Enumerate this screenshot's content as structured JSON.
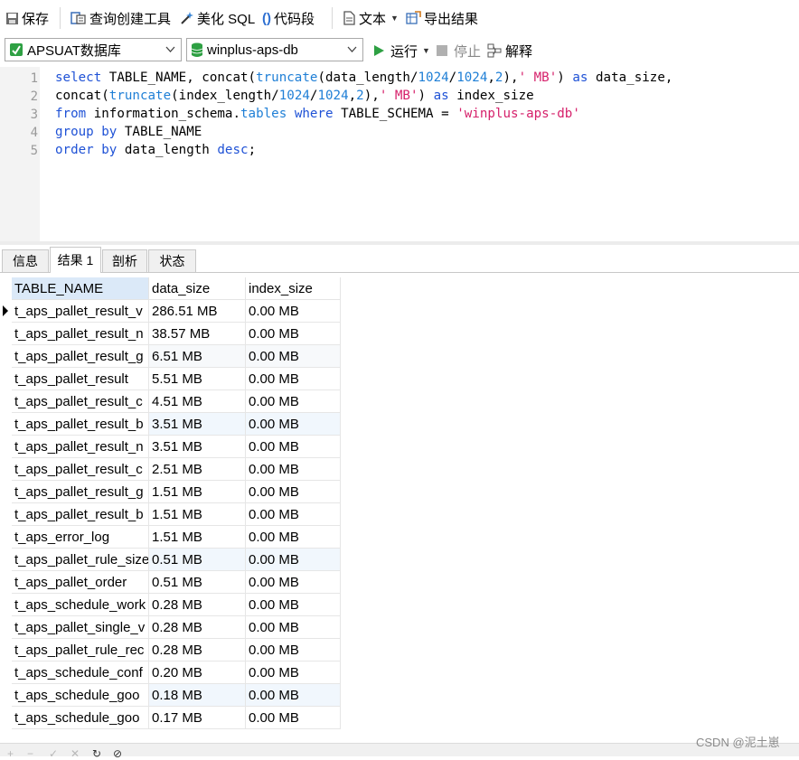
{
  "toolbar": {
    "save": "保存",
    "query_builder": "查询创建工具",
    "beautify": "美化 SQL",
    "snippet": "代码段",
    "text": "文本",
    "export": "导出结果"
  },
  "connection": {
    "connection_name": "APSUAT数据库",
    "database_name": "winplus-aps-db",
    "run": "运行",
    "stop": "停止",
    "explain": "解释"
  },
  "editor": {
    "line_numbers": [
      "1",
      "2",
      "3",
      "4",
      "5"
    ]
  },
  "result_tabs": [
    "信息",
    "结果 1",
    "剖析",
    "状态"
  ],
  "grid": {
    "columns": [
      "TABLE_NAME",
      "data_size",
      "index_size"
    ],
    "rows": [
      [
        "t_aps_pallet_result_v",
        "286.51 MB",
        "0.00 MB"
      ],
      [
        "t_aps_pallet_result_n",
        "38.57 MB",
        "0.00 MB"
      ],
      [
        "t_aps_pallet_result_g",
        "6.51 MB",
        "0.00 MB"
      ],
      [
        "t_aps_pallet_result",
        "5.51 MB",
        "0.00 MB"
      ],
      [
        "t_aps_pallet_result_c",
        "4.51 MB",
        "0.00 MB"
      ],
      [
        "t_aps_pallet_result_b",
        "3.51 MB",
        "0.00 MB"
      ],
      [
        "t_aps_pallet_result_n",
        "3.51 MB",
        "0.00 MB"
      ],
      [
        "t_aps_pallet_result_c",
        "2.51 MB",
        "0.00 MB"
      ],
      [
        "t_aps_pallet_result_g",
        "1.51 MB",
        "0.00 MB"
      ],
      [
        "t_aps_pallet_result_b",
        "1.51 MB",
        "0.00 MB"
      ],
      [
        "t_aps_error_log",
        "1.51 MB",
        "0.00 MB"
      ],
      [
        "t_aps_pallet_rule_size",
        "0.51 MB",
        "0.00 MB"
      ],
      [
        "t_aps_pallet_order",
        "0.51 MB",
        "0.00 MB"
      ],
      [
        "t_aps_schedule_work",
        "0.28 MB",
        "0.00 MB"
      ],
      [
        "t_aps_pallet_single_v",
        "0.28 MB",
        "0.00 MB"
      ],
      [
        "t_aps_pallet_rule_rec",
        "0.28 MB",
        "0.00 MB"
      ],
      [
        "t_aps_schedule_conf",
        "0.20 MB",
        "0.00 MB"
      ],
      [
        "t_aps_schedule_goo",
        "0.18 MB",
        "0.00 MB"
      ],
      [
        "t_aps_schedule_goo",
        "0.17 MB",
        "0.00 MB"
      ]
    ]
  },
  "watermark": "CSDN @泥土崽",
  "colors": {
    "keyword": "#1f52d6",
    "string": "#d6216b",
    "number": "#1f7fd6",
    "run_icon": "#2ea043",
    "db_icon": "#2ea043"
  },
  "code_lines": [
    [
      [
        "kw",
        "select"
      ],
      [
        "",
        "TABLE_NAME, "
      ],
      [
        "",
        "concat("
      ],
      [
        "fn",
        "truncate"
      ],
      [
        "",
        "(data_length/"
      ],
      [
        "num",
        "1024"
      ],
      [
        "",
        "/"
      ],
      [
        "num",
        "1024"
      ],
      [
        "",
        ","
      ],
      [
        "num",
        "2"
      ],
      [
        "",
        "),"
      ],
      [
        "str",
        "' MB'"
      ],
      [
        "",
        ") "
      ],
      [
        "kw",
        "as"
      ],
      [
        "",
        " data_size,"
      ]
    ],
    [
      [
        "",
        "concat("
      ],
      [
        "fn",
        "truncate"
      ],
      [
        "",
        "(index_length/"
      ],
      [
        "num",
        "1024"
      ],
      [
        "",
        "/"
      ],
      [
        "num",
        "1024"
      ],
      [
        "",
        ","
      ],
      [
        "num",
        "2"
      ],
      [
        "",
        "),"
      ],
      [
        "str",
        "' MB'"
      ],
      [
        "",
        ") "
      ],
      [
        "kw",
        "as"
      ],
      [
        "",
        ""
      ],
      [
        "",
        ""
      ],
      [
        "",
        ""
      ],
      " index_size"
    ],
    [
      [
        "kw",
        "from"
      ],
      [
        "",
        "",
        " information_schema."
      ],
      [
        "fn",
        "tables"
      ],
      [
        "",
        "",
        " "
      ],
      [
        "kw",
        "where"
      ],
      [
        "",
        "",
        " TABLE_SCHEMA = "
      ],
      [
        "str",
        "'winplus-aps-db'"
      ]
    ],
    [
      [
        "kw",
        "group by"
      ],
      [
        "",
        "",
        " TABLE_NAME"
      ]
    ],
    [
      [
        "kw",
        "order by"
      ],
      [
        "",
        "",
        " data_length "
      ],
      [
        "kw",
        "desc"
      ],
      [
        "",
        "",
        " ;"
      ]
    ]
  ]
}
